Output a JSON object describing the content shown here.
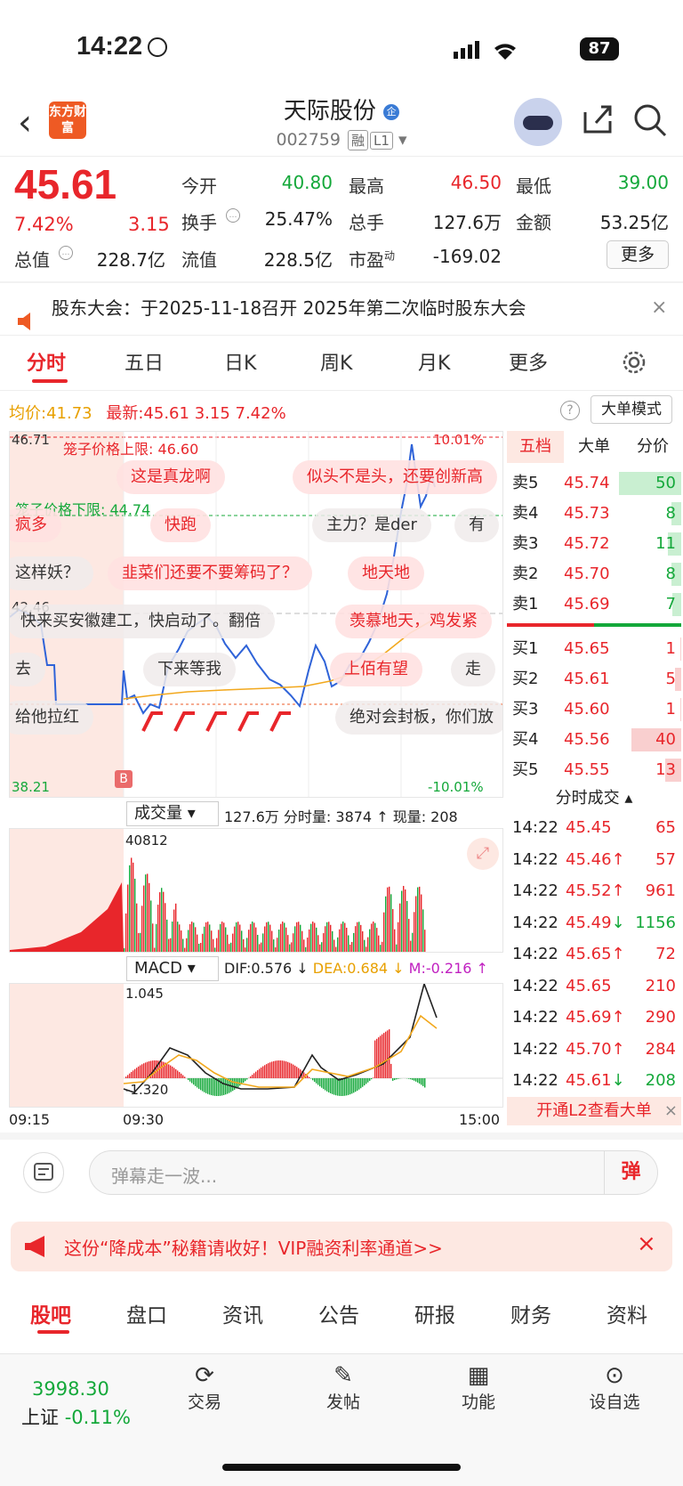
{
  "status": {
    "time": "14:22",
    "battery": "87"
  },
  "header": {
    "logo_text": "东方财富",
    "stock_name": "天际股份",
    "code": "002759",
    "badge1": "融",
    "badge2": "L1"
  },
  "quote": {
    "price": "45.61",
    "pct": "7.42%",
    "chg": "3.15",
    "row1": [
      {
        "label": "今开",
        "value": "40.80",
        "color": "green"
      },
      {
        "label": "最高",
        "value": "46.50",
        "color": "red"
      },
      {
        "label": "最低",
        "value": "39.00",
        "color": "green"
      }
    ],
    "row2": [
      {
        "label": "换手",
        "value": "25.47%"
      },
      {
        "label": "总手",
        "value": "127.6万"
      },
      {
        "label": "金额",
        "value": "53.25亿"
      }
    ],
    "row3": [
      {
        "label": "总值",
        "value": "228.7亿"
      },
      {
        "label": "流值",
        "value": "228.5亿"
      },
      {
        "label": "市盈",
        "value": "-169.02"
      }
    ],
    "pe_sup": "动",
    "more": "更多"
  },
  "notice": {
    "text": "股东大会：于2025-11-18召开 2025年第二次临时股东大会"
  },
  "tabs": [
    "分时",
    "五日",
    "日K",
    "周K",
    "月K",
    "更多"
  ],
  "chart": {
    "avg_label": "均价:",
    "avg": "41.73",
    "last_label": "最新:",
    "last": "45.61",
    "chg": "3.15",
    "pct": "7.42%",
    "bigmode": "大单模式",
    "ymax": "46.71",
    "ymin": "38.21",
    "pmax": "10.01%",
    "pmin": "-10.01%",
    "mid": "42.46",
    "cage_up": "笼子价格上限: 46.60",
    "cage_down": "笼子价格下限: 44.74",
    "vol_label": "成交量",
    "vol_total": "127.6万",
    "vol_min": "分时量: 3874",
    "vol_now": "现量: 208",
    "vol_max": "40812",
    "macd_label": "MACD",
    "dif": "DIF:0.576 ↓",
    "dea": "DEA:0.684 ↓",
    "m": "M:-0.216 ↑",
    "macd_max": "1.045",
    "macd_min": "-1.320",
    "t0": "09:15",
    "t1": "09:30",
    "t2": "15:00",
    "b_marker": "B"
  },
  "danmu": [
    "这是真龙啊",
    "似头不是头，还要创新高",
    "疯多",
    "快跑",
    "主力？是der",
    "有",
    "这样妖？",
    "韭菜们还要不要筹码了？",
    "地天地",
    "快来买安徽建工，快启动了。翻倍",
    "羡慕地天，鸡发紧",
    "去",
    "下来等我",
    "上佰有望",
    "走",
    "给他拉红",
    "绝对会封板，你们放"
  ],
  "orderbook": {
    "tabs": [
      "五档",
      "大单",
      "分价"
    ],
    "sells": [
      {
        "l": "卖5",
        "p": "45.74",
        "v": "50"
      },
      {
        "l": "卖4",
        "p": "45.73",
        "v": "8"
      },
      {
        "l": "卖3",
        "p": "45.72",
        "v": "11"
      },
      {
        "l": "卖2",
        "p": "45.70",
        "v": "8"
      },
      {
        "l": "卖1",
        "p": "45.69",
        "v": "7"
      }
    ],
    "buys": [
      {
        "l": "买1",
        "p": "45.65",
        "v": "1"
      },
      {
        "l": "买2",
        "p": "45.61",
        "v": "5"
      },
      {
        "l": "买3",
        "p": "45.60",
        "v": "1"
      },
      {
        "l": "买4",
        "p": "45.56",
        "v": "40"
      },
      {
        "l": "买5",
        "p": "45.55",
        "v": "13"
      }
    ],
    "trades_title": "分时成交",
    "trades": [
      {
        "t": "14:22",
        "p": "45.45",
        "a": "",
        "v": "65",
        "c": "red"
      },
      {
        "t": "14:22",
        "p": "45.46",
        "a": "↑",
        "v": "57",
        "c": "red"
      },
      {
        "t": "14:22",
        "p": "45.52",
        "a": "↑",
        "v": "961",
        "c": "red"
      },
      {
        "t": "14:22",
        "p": "45.49",
        "a": "↓",
        "v": "1156",
        "c": "green"
      },
      {
        "t": "14:22",
        "p": "45.65",
        "a": "↑",
        "v": "72",
        "c": "red"
      },
      {
        "t": "14:22",
        "p": "45.65",
        "a": "",
        "v": "210",
        "c": "red"
      },
      {
        "t": "14:22",
        "p": "45.69",
        "a": "↑",
        "v": "290",
        "c": "red"
      },
      {
        "t": "14:22",
        "p": "45.70",
        "a": "↑",
        "v": "284",
        "c": "red"
      },
      {
        "t": "14:22",
        "p": "45.61",
        "a": "↓",
        "v": "208",
        "c": "green"
      }
    ],
    "l2": "开通L2查看大单"
  },
  "comment": {
    "placeholder": "弹幕走一波...",
    "btn": "弹"
  },
  "ad": {
    "text": "这份“降成本”秘籍请收好！VIP融资利率通道>>"
  },
  "bottom_tabs": [
    "股吧",
    "盘口",
    "资讯",
    "公告",
    "研报",
    "财务",
    "资料"
  ],
  "nav": {
    "index_value": "3998.30",
    "index_name": "上证",
    "index_pct": "-0.11%",
    "items": [
      "交易",
      "发帖",
      "功能",
      "设自选"
    ]
  }
}
